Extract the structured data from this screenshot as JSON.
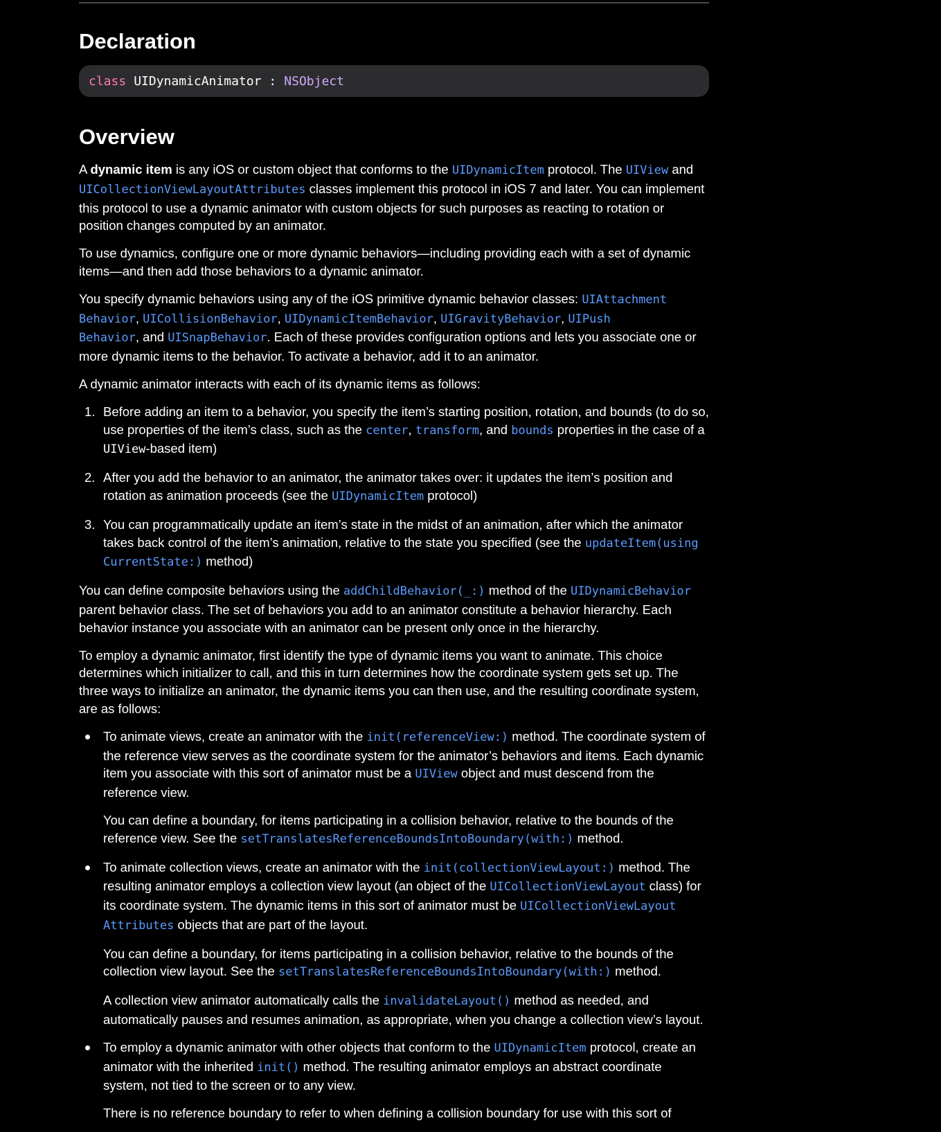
{
  "declaration": {
    "heading": "Declaration",
    "keyword": "class",
    "name": "UIDynamicAnimator",
    "separator": ":",
    "superclass": "NSObject"
  },
  "overview": {
    "heading": "Overview",
    "p1": {
      "t1": "A ",
      "bold": "dynamic item",
      "t2": " is any iOS or custom object that conforms to the ",
      "l1": "UIDynamicItem",
      "t3": " protocol. The ",
      "l2": "UIView",
      "t4": " and ",
      "l3": "UICollectionViewLayoutAttributes",
      "t5": " classes implement this protocol in iOS 7 and later. You can implement this protocol to use a dynamic animator with custom objects for such purposes as reacting to rotation or position changes computed by an animator."
    },
    "p2": "To use dynamics, configure one or more dynamic behaviors—including providing each with a set of dynamic items—and then add those behaviors to a dynamic animator.",
    "p3": {
      "t1": "You specify dynamic behaviors using any of the iOS primitive dynamic behavior classes: ",
      "l1a": "UIAttachment",
      "l1b": "Behavior",
      "c1": ", ",
      "l2": "UICollisionBehavior",
      "c2": ", ",
      "l3": "UIDynamicItemBehavior",
      "c3": ", ",
      "l4": "UIGravityBehavior",
      "c4": ", ",
      "l5a": "UIPush",
      "l5b": "Behavior",
      "t2": ", and ",
      "l6": "UISnapBehavior",
      "t3": ". Each of these provides configuration options and lets you associate one or more dynamic items to the behavior. To activate a behavior, add it to an animator."
    },
    "p4": "A dynamic animator interacts with each of its dynamic items as follows:",
    "steps": [
      {
        "num": "1.",
        "t1": "Before adding an item to a behavior, you specify the item’s starting position, rotation, and bounds (to do so, use properties of the item’s class, such as the ",
        "l1": "center",
        "c1": ", ",
        "l2": "transform",
        "t2": ", and ",
        "l3": "bounds",
        "t3": " properties in the case of a ",
        "code": "UIView",
        "t4": "-based item)"
      },
      {
        "num": "2.",
        "t1": "After you add the behavior to an animator, the animator takes over: it updates the item’s position and rotation as animation proceeds (see the ",
        "l1": "UIDynamicItem",
        "t2": " protocol)"
      },
      {
        "num": "3.",
        "t1": "You can programmatically update an item’s state in the midst of an animation, after which the animator takes back control of the item’s animation, relative to the state you specified (see the ",
        "l1a": "updateItem(using",
        "l1b": "CurrentState:)",
        "t2": " method)"
      }
    ],
    "p5": {
      "t1": "You can define composite behaviors using the ",
      "l1": "addChildBehavior(_:)",
      "t2": " method of the ",
      "l2": "UIDynamicBehavior",
      "t3": " parent behavior class. The set of behaviors you add to an animator constitute a behavior hierarchy. Each behavior instance you associate with an animator can be present only once in the hierarchy."
    },
    "p6": "To employ a dynamic animator, first identify the type of dynamic items you want to animate. This choice determines which initializer to call, and this in turn determines how the coordinate system gets set up. The three ways to initialize an animator, the dynamic items you can then use, and the resulting coordinate system, are as follows:",
    "bullets": [
      {
        "a": {
          "t1": "To animate views, create an animator with the ",
          "l1": "init(referenceView:)",
          "t2": " method. The coordinate system of the reference view serves as the coordinate system for the animator’s behaviors and items. Each dynamic item you associate with this sort of animator must be a ",
          "l2": "UIView",
          "t3": " object and must descend from the reference view."
        },
        "b": {
          "t1": "You can define a boundary, for items participating in a collision behavior, relative to the bounds of the reference view. See the ",
          "l1": "setTranslatesReferenceBoundsIntoBoundary(with:)",
          "t2": " method."
        }
      },
      {
        "a": {
          "t1": "To animate collection views, create an animator with the ",
          "l1": "init(collectionViewLayout:)",
          "t2": " method. The resulting animator employs a collection view layout (an object of the ",
          "l2": "UICollectionViewLayout",
          "t3": " class) for its coordinate system. The dynamic items in this sort of animator must be ",
          "l3a": "UICollectionViewLayout",
          "l3b": "Attributes",
          "t4": " objects that are part of the layout."
        },
        "b": {
          "t1": "You can define a boundary, for items participating in a collision behavior, relative to the bounds of the collection view layout. See the ",
          "l1": "setTranslatesReferenceBoundsIntoBoundary(with:)",
          "t2": " method."
        },
        "c": {
          "t1": "A collection view animator automatically calls the ",
          "l1": "invalidateLayout()",
          "t2": " method as needed, and automatically pauses and resumes animation, as appropriate, when you change a collection view’s layout."
        }
      },
      {
        "a": {
          "t1": "To employ a dynamic animator with other objects that conform to the ",
          "l1": "UIDynamicItem",
          "t2": " protocol, create an animator with the inherited ",
          "l2": "init()",
          "t3": " method. The resulting animator employs an abstract coordinate system, not tied to the screen or to any view."
        },
        "b": {
          "t1": "There is no reference boundary to refer to when defining a collision boundary for use with this sort of"
        }
      }
    ]
  }
}
